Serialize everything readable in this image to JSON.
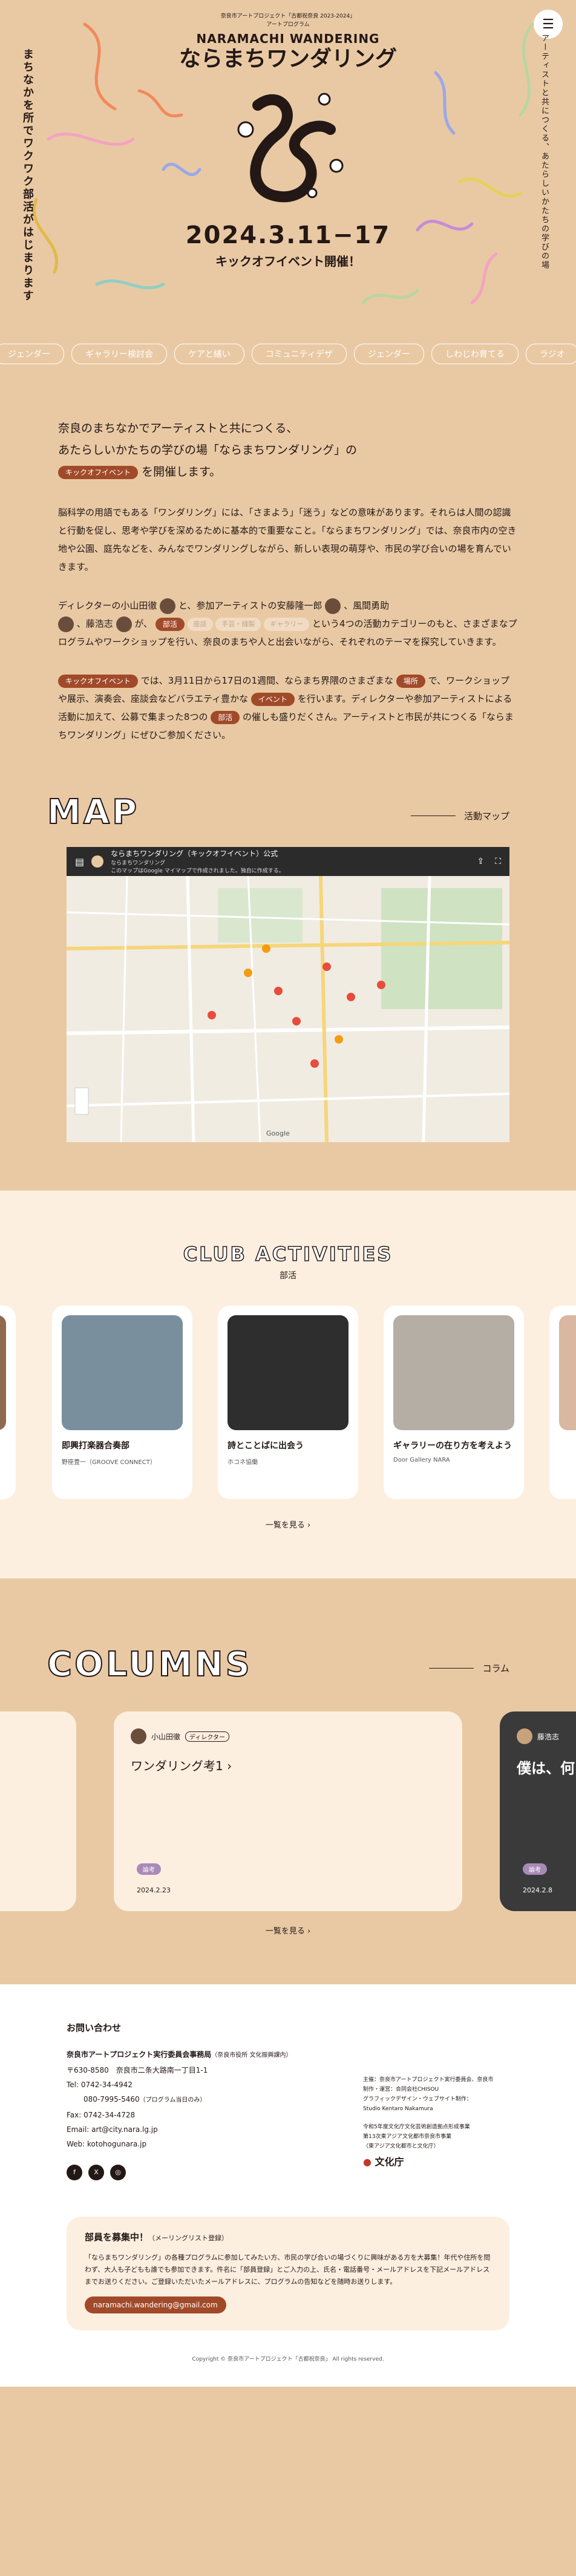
{
  "hero": {
    "menu_icon": "menu-icon",
    "project_line1": "奈良市アートプロジェクト「古都祝奈良 2023-2024」",
    "project_line2": "アートプログラム",
    "logo_en": "NARAMACHI WANDERING",
    "logo_jp": "ならまちワンダリング",
    "vertical_left": "まちなかを所でワクワク部活がはじまります",
    "vertical_right": "アーティストと共につくる、あたらしいかたちの学びの場",
    "date": "2024.3.11−17",
    "kickoff": "キックオフイベント開催！"
  },
  "tags": [
    "ジェンダー",
    "ギャラリー検討会",
    "ケアと繕い",
    "コミュニティデザ",
    "ジェンダー",
    "しわじわ育てる",
    "ラジオ"
  ],
  "intro": {
    "lead1": "奈良のまちなかでアーティストと共につくる、",
    "lead2": "あたらしいかたちの学びの場「ならまちワンダリング」の",
    "lead_badge": "キックオフイベント",
    "lead3": "を開催します。",
    "p2": "脳科学の用語でもある「ワンダリング」には、「さまよう」「迷う」などの意味があります。それらは人間の認識と行動を促し、思考や学びを深めるために基本的で重要なこと。「ならまちワンダリング」では、奈良市内の空き地や公園、庭先などを、みんなでワンダリングしながら、新しい表現の萌芽や、市民の学び合いの場を育んでいきます。",
    "p3_a": "ディレクターの小山田徹",
    "p3_b": "と、参加アーティストの安藤隆一郎",
    "p3_c": "、風間勇助",
    "p3_d": "、藤浩志",
    "p3_e": "が、",
    "p3_badge1": "部活",
    "p3_badge2": "座談",
    "p3_badge3": "手芸・縫製",
    "p3_badge4": "ギャラリー",
    "p3_f": "という4つの活動カテゴリーのもと、さまざまなプログラムやワークショップを行い、奈良のまちや人と出会いながら、それぞれのテーマを探究していきます。",
    "p4_badge1": "キックオフイベント",
    "p4_a": "では、3月11日から17日の1週間、ならまち界隈のさまざまな",
    "p4_badge2": "場所",
    "p4_b": "で、ワークショップや展示、演奏会、座談会などバラエティ豊かな",
    "p4_badge3": "イベント",
    "p4_c": "を行います。ディレクターや参加アーティストによる活動に加えて、公募で集まった8つの",
    "p4_badge4": "部活",
    "p4_d": "の催しも盛りだくさん。アーティストと市民が共につくる「ならまちワンダリング」にぜひご参加ください。"
  },
  "map_section": {
    "title_en": "MAP",
    "label": "活動マップ",
    "map_title": "ならまちワンダリング（キックオフイベント）公式",
    "map_sub": "ならまちワンダリング",
    "map_sub2": "このマップはGoogle マイマップで作成されました。独自に作成する。",
    "google": "Google"
  },
  "club_section": {
    "title_en": "CLUB ACTIVITIES",
    "label": "部活",
    "cards": [
      {
        "title": "即興打楽器合奏部",
        "who": "野座豊一（GROOVE CONNECT）"
      },
      {
        "title": "詩とことばに出会う",
        "who": "ホコネ協働"
      },
      {
        "title": "ギャラリーの在り方を考えよう",
        "who": "Door Gallery NARA"
      }
    ],
    "more": "一覧を見る"
  },
  "columns_section": {
    "title_en": "COLUMNS",
    "label": "コラム",
    "cards": [
      {
        "author": "小山田徹",
        "role": "ディレクター",
        "title": "ワンダリング考1",
        "badge": "論考",
        "date": "2024.2.23"
      },
      {
        "author": "藤浩志",
        "title": "僕は、何を",
        "badge": "論考",
        "date": "2024.2.8"
      }
    ],
    "more": "一覧を見る"
  },
  "footer": {
    "contact_title": "お問い合わせ",
    "org": "奈良市アートプロジェクト実行委員会事務局",
    "org_note": "（奈良市役所 文化振興課内）",
    "postal": "〒630-8580　奈良市二条大路南一丁目1-1",
    "tel": "Tel: 0742-34-4942",
    "tel2": "080-7995-5460",
    "tel2_note": "（プログラム当日のみ）",
    "fax": "Fax: 0742-34-4728",
    "email": "Email: art@city.nara.lg.jp",
    "web": "Web: kotohogunara.jp",
    "credits1": "主催：奈良市アートプロジェクト実行委員会、奈良市",
    "credits2": "制作・運営：合同会社CHISOU",
    "credits3": "グラフィックデザイン・ウェブサイト制作：",
    "credits4": "Studio Kentaro Nakamura",
    "credits5": "令和5年度文化庁文化芸術創造拠点形成事業",
    "credits6": "第13次東アジア文化都市奈良市事業",
    "credits7": "（東アジア文化都市と文化庁）",
    "bunka": "文化庁",
    "recruit_title": "部員を募集中！",
    "recruit_title_note": "（メーリングリスト登録）",
    "recruit_body": "「ならまちワンダリング」の各種プログラムに参加してみたい方、市民の学び合いの場づくりに興味がある方を大募集！年代や住所を問わず、大人も子どもも誰でも参加できます。件名に「部員登録」とご入力の上、氏名・電話番号・メールアドレスを下記メールアドレスまでお送りください。ご登録いただいたメールアドレスに、プログラムの告知などを随時お送りします。",
    "recruit_email": "naramachi.wandering@gmail.com",
    "copyright": "Copyright © 奈良市アートプロジェクト「古都祝奈良」 All rights reserved."
  }
}
